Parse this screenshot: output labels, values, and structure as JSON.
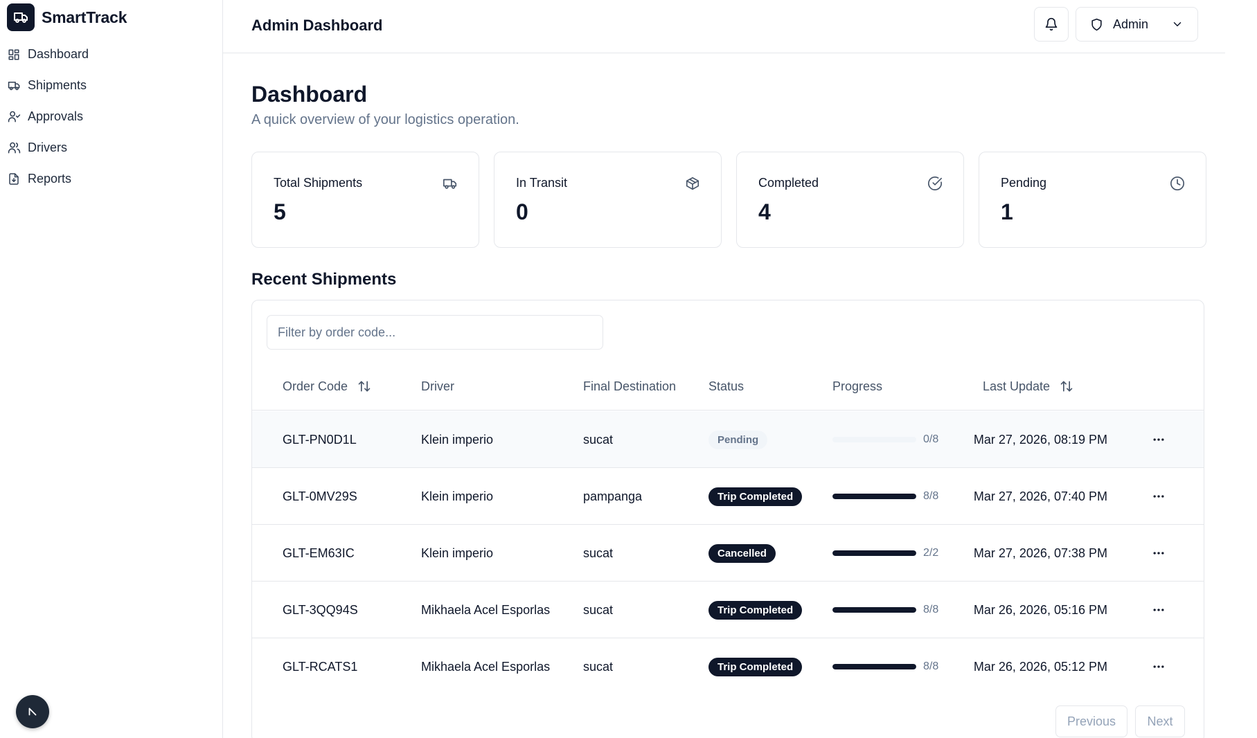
{
  "app": {
    "name": "SmartTrack"
  },
  "sidebar": {
    "items": [
      {
        "label": "Dashboard",
        "icon": "layout-grid-icon"
      },
      {
        "label": "Shipments",
        "icon": "truck-icon"
      },
      {
        "label": "Approvals",
        "icon": "user-check-icon"
      },
      {
        "label": "Drivers",
        "icon": "users-icon"
      },
      {
        "label": "Reports",
        "icon": "file-download-icon"
      }
    ]
  },
  "header": {
    "title": "Admin Dashboard",
    "user_label": "Admin"
  },
  "main": {
    "title": "Dashboard",
    "subtitle": "A quick overview of your logistics operation.",
    "stats": [
      {
        "label": "Total Shipments",
        "value": "5",
        "icon": "truck-icon"
      },
      {
        "label": "In Transit",
        "value": "0",
        "icon": "package-icon"
      },
      {
        "label": "Completed",
        "value": "4",
        "icon": "check-circle-icon"
      },
      {
        "label": "Pending",
        "value": "1",
        "icon": "clock-icon"
      }
    ],
    "recent": {
      "title": "Recent Shipments",
      "filter_placeholder": "Filter by order code...",
      "columns": [
        "Order Code",
        "Driver",
        "Final Destination",
        "Status",
        "Progress",
        "Last Update"
      ],
      "rows": [
        {
          "code": "GLT-PN0D1L",
          "driver": "Klein imperio",
          "destination": "sucat",
          "status": "Pending",
          "progress_done": 0,
          "progress_total": 8,
          "progress_text": "0/8",
          "updated": "Mar 27, 2026, 08:19 PM"
        },
        {
          "code": "GLT-0MV29S",
          "driver": "Klein imperio",
          "destination": "pampanga",
          "status": "Trip Completed",
          "progress_done": 8,
          "progress_total": 8,
          "progress_text": "8/8",
          "updated": "Mar 27, 2026, 07:40 PM"
        },
        {
          "code": "GLT-EM63IC",
          "driver": "Klein imperio",
          "destination": "sucat",
          "status": "Cancelled",
          "progress_done": 2,
          "progress_total": 2,
          "progress_text": "2/2",
          "updated": "Mar 27, 2026, 07:38 PM"
        },
        {
          "code": "GLT-3QQ94S",
          "driver": "Mikhaela Acel Esporlas",
          "destination": "sucat",
          "status": "Trip Completed",
          "progress_done": 8,
          "progress_total": 8,
          "progress_text": "8/8",
          "updated": "Mar 26, 2026, 05:16 PM"
        },
        {
          "code": "GLT-RCATS1",
          "driver": "Mikhaela Acel Esporlas",
          "destination": "sucat",
          "status": "Trip Completed",
          "progress_done": 8,
          "progress_total": 8,
          "progress_text": "8/8",
          "updated": "Mar 26, 2026, 05:12 PM"
        }
      ],
      "pager": {
        "previous": "Previous",
        "next": "Next"
      }
    }
  },
  "colors": {
    "primary": "#0f172a",
    "muted": "#64748b",
    "border": "#e5e7eb",
    "badge_light_bg": "#f1f5f9"
  }
}
